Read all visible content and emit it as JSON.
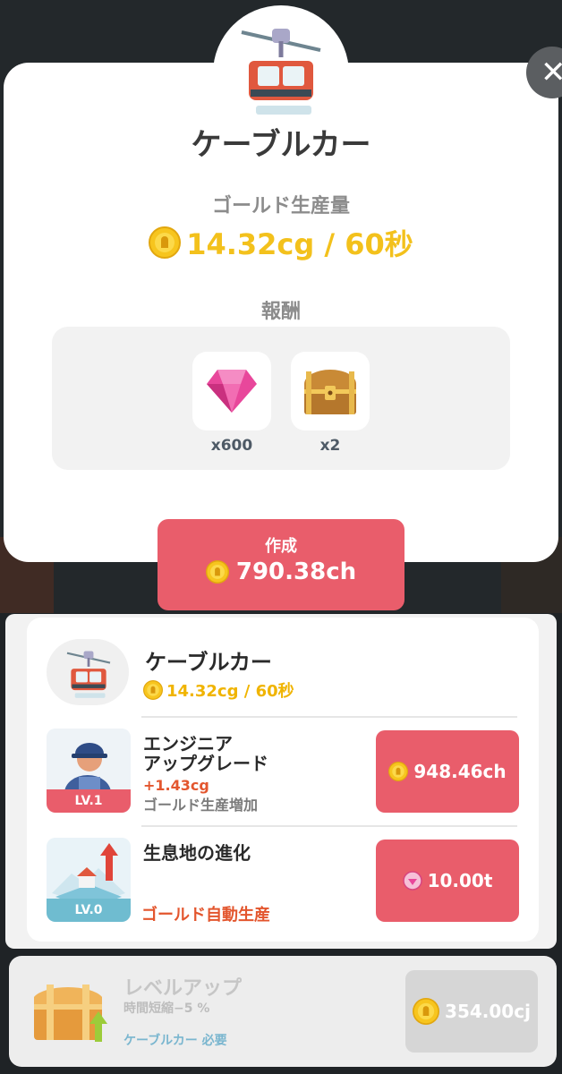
{
  "modal": {
    "title": "ケーブルカー",
    "gold_label": "ゴールド生産量",
    "gold_rate": "14.32cg / 60秒",
    "reward_label": "報酬",
    "rewards": [
      {
        "icon": "gem-icon",
        "qty": "x600"
      },
      {
        "icon": "treasure-chest-icon",
        "qty": "x2"
      }
    ],
    "create": {
      "label": "作成",
      "cost": "790.38ch"
    }
  },
  "panel": {
    "title": "ケーブルカー",
    "rate": "14.32cg / 60秒",
    "upgrades": [
      {
        "title_line1": "エンジニア",
        "title_line2": "アップグレード",
        "bonus": "+1.43cg",
        "desc": "ゴールド生産増加",
        "level": "LV.1",
        "cost": "948.46ch"
      },
      {
        "title": "生息地の進化",
        "desc": "ゴールド自動生産",
        "level": "LV.0",
        "cost": "10.00t"
      }
    ]
  },
  "level_up": {
    "title": "レベルアップ",
    "subtitle": "時間短縮−5 %",
    "requirement": "ケーブルカー 必要",
    "cost": "354.00cj"
  },
  "colors": {
    "accent": "#e95d6b",
    "gold": "#f3c11c",
    "bonus": "#e3562e"
  }
}
